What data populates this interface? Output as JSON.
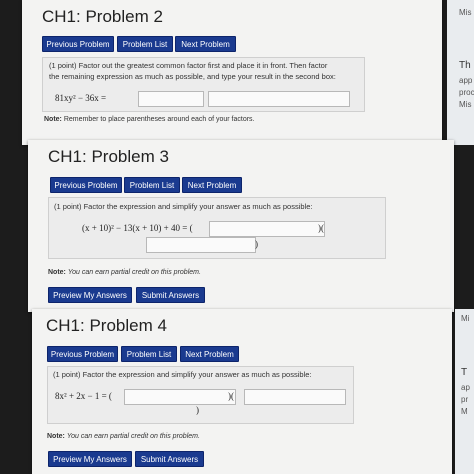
{
  "problem2": {
    "title": "CH1: Problem 2",
    "buttons": [
      "Previous Problem",
      "Problem List",
      "Next Problem"
    ],
    "prompt_line1": "(1 point) Factor out the greatest common factor first and place it in front. Then factor",
    "prompt_line2": "the remaining expression as much as possible, and type your result in the second box:",
    "expression": "81xy² − 36x =",
    "note_label": "Note:",
    "note_text": "Remember to place parentheses around each of your factors."
  },
  "problem3": {
    "title": "CH1: Problem 3",
    "buttons": [
      "Previous Problem",
      "Problem List",
      "Next Problem"
    ],
    "prompt": "(1 point) Factor the expression and simplify your answer as much as possible:",
    "expression": "(x + 10)² − 13(x + 10) + 40 = (",
    "paren_mid": ")(",
    "paren_end": ")",
    "note_label": "Note:",
    "note_text": "You can earn partial credit on this problem.",
    "actions": [
      "Preview My Answers",
      "Submit Answers"
    ]
  },
  "problem4": {
    "title": "CH1: Problem 4",
    "buttons": [
      "Previous Problem",
      "Problem List",
      "Next Problem"
    ],
    "prompt": "(1 point) Factor the expression and simplify your answer as much as possible:",
    "expression": "8x² + 2x − 1 = (",
    "paren_mid": ")(",
    "paren_end": ")",
    "note_label": "Note:",
    "note_text": "You can earn partial credit on this problem.",
    "actions": [
      "Preview My Answers",
      "Submit Answers"
    ]
  },
  "sidebar_fragments": {
    "top_right": "Mis",
    "s2_a": "Th",
    "s2_b": "app",
    "s2_c": "proc",
    "s2_d": "Mis",
    "s4_a": "Mi",
    "s4_b": "T",
    "s4_c": "ap",
    "s4_d": "pr",
    "s4_e": "M"
  },
  "colors": {
    "button": "#1a3a8f",
    "panel": "#f3f3f2",
    "background": "#1c1c1c"
  }
}
